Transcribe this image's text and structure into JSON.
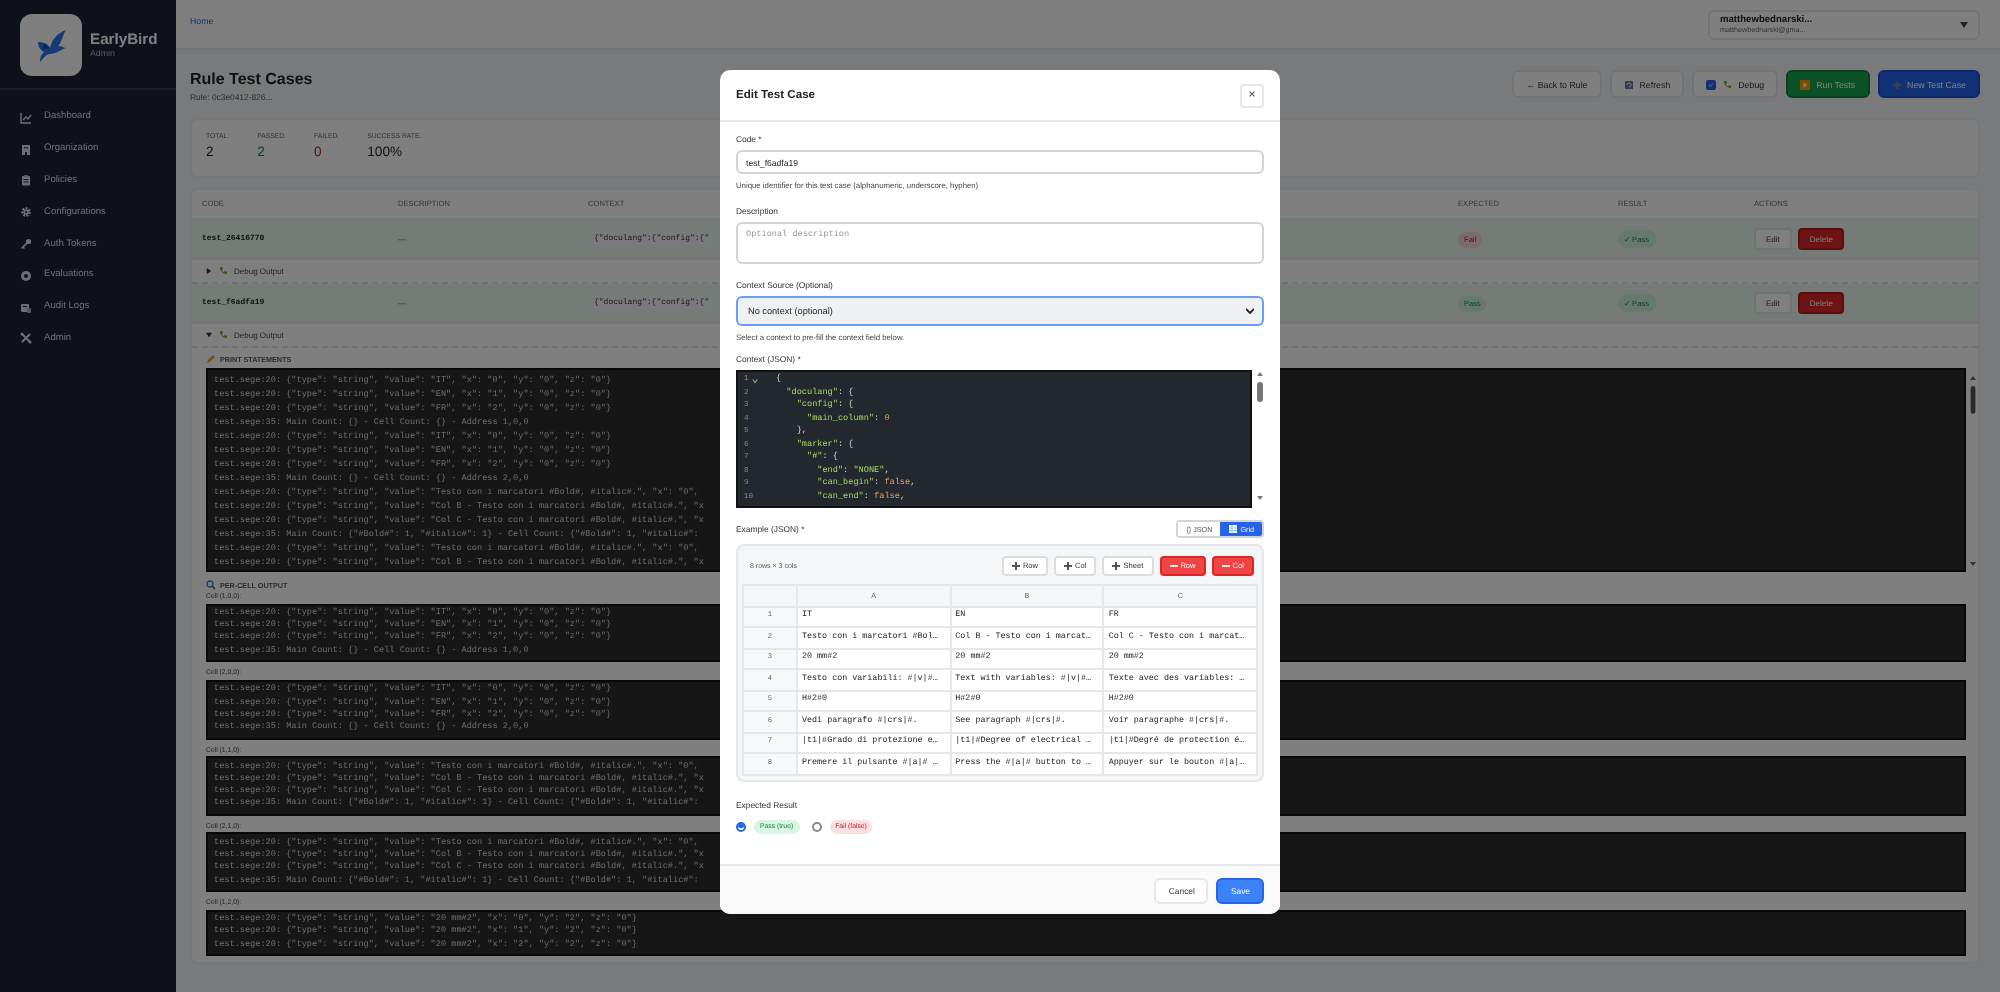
{
  "sidebar": {
    "brand": "EarlyBird",
    "role": "Admin",
    "items": [
      {
        "label": "Dashboard",
        "kind": "chart"
      },
      {
        "label": "Organization",
        "kind": "building"
      },
      {
        "label": "Policies",
        "kind": "clipboard"
      },
      {
        "label": "Configurations",
        "kind": "gear"
      },
      {
        "label": "Auth Tokens",
        "kind": "key"
      },
      {
        "label": "Evaluations",
        "kind": "target"
      },
      {
        "label": "Audit Logs",
        "kind": "scroll"
      },
      {
        "label": "Admin",
        "kind": "tools"
      }
    ]
  },
  "header": {
    "breadcrumb": "Home",
    "user_name": "matthewbednarski...",
    "user_email": "matthewbednarski@gma..."
  },
  "page": {
    "title": "Rule Test Cases",
    "subtitle": "Rule: 0c3e0412-826...",
    "actions": [
      {
        "label": "← Back to Rule",
        "kind": "plain"
      },
      {
        "label": "Refresh",
        "kind": "refresh"
      },
      {
        "label": "Debug",
        "kind": "toggle",
        "checked": true
      },
      {
        "label": "Run Tests",
        "kind": "run"
      },
      {
        "label": "New Test Case",
        "kind": "new"
      }
    ]
  },
  "stats": [
    {
      "label": "TOTAL:",
      "value": "2",
      "kind": "neutral"
    },
    {
      "label": "PASSED:",
      "value": "2",
      "kind": "pass"
    },
    {
      "label": "FAILED:",
      "value": "0",
      "kind": "fail"
    },
    {
      "label": "SUCCESS RATE:",
      "value": "100%",
      "kind": "neutral"
    }
  ],
  "table": {
    "columns": [
      "CODE",
      "DESCRIPTION",
      "CONTEXT",
      "EXPECTED",
      "RESULT",
      "ACTIONS"
    ],
    "rows": [
      {
        "code": "test_26416770",
        "description": "—",
        "context": "{\"doculang\":{\"config\":{\"",
        "expected": {
          "text": "Fail",
          "kind": "fail"
        },
        "result": {
          "text": "✓ Pass",
          "kind": "pass"
        },
        "actions": [
          "Edit",
          "Delete"
        ],
        "debug": {
          "label": "Debug Output",
          "expanded": false
        }
      },
      {
        "code": "test_f6adfa19",
        "description": "—",
        "context": "{\"doculang\":{\"config\":{\"",
        "expected": {
          "text": "Pass",
          "kind": "pass"
        },
        "result": {
          "text": "✓ Pass",
          "kind": "pass"
        },
        "actions": [
          "Edit",
          "Delete"
        ],
        "debug": {
          "label": "Debug Output",
          "expanded": true
        }
      }
    ]
  },
  "debug": {
    "print_title": "PRINT STATEMENTS",
    "print_lines": [
      "test.sege:20: {\"type\": \"string\", \"value\": \"IT\", \"x\": \"0\", \"y\": \"0\", \"z\": \"0\"}",
      "test.sege:20: {\"type\": \"string\", \"value\": \"EN\", \"x\": \"1\", \"y\": \"0\", \"z\": \"0\"}",
      "test.sege:20: {\"type\": \"string\", \"value\": \"FR\", \"x\": \"2\", \"y\": \"0\", \"z\": \"0\"}",
      "test.sege:35: Main Count: {} - Cell Count: {} - Address 1,0,0",
      "test.sege:20: {\"type\": \"string\", \"value\": \"IT\", \"x\": \"0\", \"y\": \"0\", \"z\": \"0\"}",
      "test.sege:20: {\"type\": \"string\", \"value\": \"EN\", \"x\": \"1\", \"y\": \"0\", \"z\": \"0\"}",
      "test.sege:20: {\"type\": \"string\", \"value\": \"FR\", \"x\": \"2\", \"y\": \"0\", \"z\": \"0\"}",
      "test.sege:35: Main Count: {} - Cell Count: {} - Address 2,0,0",
      "test.sege:20: {\"type\": \"string\", \"value\": \"Testo con i marcatori #Bold#, #italic#.\", \"x\": \"0\",",
      "test.sege:20: {\"type\": \"string\", \"value\": \"Col B - Testo con i marcatori #Bold#, #italic#.\", \"x",
      "test.sege:20: {\"type\": \"string\", \"value\": \"Col C - Testo con i marcatori #Bold#, #italic#.\", \"x",
      "test.sege:35: Main Count: {\"#Bold#\": 1, \"#italic#\": 1} - Cell Count: {\"#Bold#\": 1, \"#italic#\":",
      "test.sege:20: {\"type\": \"string\", \"value\": \"Testo con i marcatori #Bold#, #italic#.\", \"x\": \"0\",",
      "test.sege:20: {\"type\": \"string\", \"value\": \"Col B - Testo con i marcatori #Bold#, #italic#.\", \"x"
    ],
    "cell_title": "PER-CELL OUTPUT",
    "cells": [
      {
        "label": "Cell (1,0,0):",
        "lines": [
          "test.sege:20: {\"type\": \"string\", \"value\": \"IT\", \"x\": \"0\", \"y\": \"0\", \"z\": \"0\"}",
          "test.sege:20: {\"type\": \"string\", \"value\": \"EN\", \"x\": \"1\", \"y\": \"0\", \"z\": \"0\"}",
          "test.sege:20: {\"type\": \"string\", \"value\": \"FR\", \"x\": \"2\", \"y\": \"0\", \"z\": \"0\"}",
          "test.sege:35: Main Count: {} - Cell Count: {} - Address 1,0,0"
        ]
      },
      {
        "label": "Cell (2,0,0):",
        "lines": [
          "test.sege:20: {\"type\": \"string\", \"value\": \"IT\", \"x\": \"0\", \"y\": \"0\", \"z\": \"0\"}",
          "test.sege:20: {\"type\": \"string\", \"value\": \"EN\", \"x\": \"1\", \"y\": \"0\", \"z\": \"0\"}",
          "test.sege:20: {\"type\": \"string\", \"value\": \"FR\", \"x\": \"2\", \"y\": \"0\", \"z\": \"0\"}",
          "test.sege:35: Main Count: {} - Cell Count: {} - Address 2,0,0"
        ]
      },
      {
        "label": "Cell (1,1,0):",
        "lines": [
          "test.sege:20: {\"type\": \"string\", \"value\": \"Testo con i marcatori #Bold#, #italic#.\", \"x\": \"0\",",
          "test.sege:20: {\"type\": \"string\", \"value\": \"Col B - Testo con i marcatori #Bold#, #italic#.\", \"x",
          "test.sege:20: {\"type\": \"string\", \"value\": \"Col C - Testo con i marcatori #Bold#, #italic#.\", \"x",
          "test.sege:35: Main Count: {\"#Bold#\": 1, \"#italic#\": 1} - Cell Count: {\"#Bold#\": 1, \"#italic#\":"
        ]
      },
      {
        "label": "Cell (2,1,0):",
        "lines": [
          "test.sege:20: {\"type\": \"string\", \"value\": \"Testo con i marcatori #Bold#, #italic#.\", \"x\": \"0\",",
          "test.sege:20: {\"type\": \"string\", \"value\": \"Col B - Testo con i marcatori #Bold#, #italic#.\", \"x",
          "test.sege:20: {\"type\": \"string\", \"value\": \"Col C - Testo con i marcatori #Bold#, #italic#.\", \"x",
          "test.sege:35: Main Count: {\"#Bold#\": 1, \"#italic#\": 1} - Cell Count: {\"#Bold#\": 1, \"#italic#\":"
        ]
      },
      {
        "label": "Cell (1,2,0):",
        "lines": [
          "test.sege:20: {\"type\": \"string\", \"value\": \"20 mm#2\", \"x\": \"0\", \"y\": \"2\", \"z\": \"0\"}",
          "test.sege:20: {\"type\": \"string\", \"value\": \"20 mm#2\", \"x\": \"1\", \"y\": \"2\", \"z\": \"0\"}",
          "test.sege:20: {\"type\": \"string\", \"value\": \"20 mm#2\", \"x\": \"2\", \"y\": \"2\", \"z\": \"0\"}"
        ]
      }
    ]
  },
  "modal": {
    "title": "Edit Test Case",
    "close": "×",
    "code": {
      "label": "Code *",
      "value": "test_f6adfa19",
      "hint": "Unique identifier for this test case (alphanumeric, underscore, hyphen)"
    },
    "description": {
      "label": "Description",
      "placeholder": "Optional description"
    },
    "context_source": {
      "label": "Context Source (Optional)",
      "value": "No context (optional)",
      "hint": "Select a context to pre-fill the context field below."
    },
    "context": {
      "label": "Context (JSON) *",
      "lines": [
        {
          "number": "1",
          "text": "{"
        },
        {
          "number": "2",
          "text": "  \"doculang\": {"
        },
        {
          "number": "3",
          "text": "    \"config\": {"
        },
        {
          "number": "4",
          "text": "      \"main_column\": 0"
        },
        {
          "number": "5",
          "text": "    },"
        },
        {
          "number": "6",
          "text": "    \"marker\": {"
        },
        {
          "number": "7",
          "text": "      \"#\": {"
        },
        {
          "number": "8",
          "text": "        \"end\": \"NONE\","
        },
        {
          "number": "9",
          "text": "        \"can_begin\": false,"
        },
        {
          "number": "10",
          "text": "        \"can_end\": false,"
        }
      ]
    },
    "example": {
      "label": "Example (JSON) *",
      "views": [
        {
          "label": "{} JSON",
          "kind": "json",
          "selected": false
        },
        {
          "label": "Grid",
          "kind": "grid",
          "selected": true
        }
      ],
      "size": "8 rows × 3 cols",
      "buttons": [
        {
          "label": "Row",
          "kind": "add"
        },
        {
          "label": "Col",
          "kind": "add"
        },
        {
          "label": "Sheet",
          "kind": "add"
        },
        {
          "label": "Row",
          "kind": "remove"
        },
        {
          "label": "Col",
          "kind": "remove"
        }
      ],
      "columns": [
        "A",
        "B",
        "C"
      ],
      "rows": [
        {
          "number": "1",
          "cells": [
            "IT",
            "EN",
            "FR"
          ]
        },
        {
          "number": "2",
          "cells": [
            "Testo con i marcatori #Bol…",
            "Col B - Testo con i marcat…",
            "Col C - Testo con i marcat…"
          ]
        },
        {
          "number": "3",
          "cells": [
            "20 mm#2",
            "20 mm#2",
            "20 mm#2"
          ]
        },
        {
          "number": "4",
          "cells": [
            "Testo con variabili: #|v|#…",
            "Text with variables: #|v|#…",
            "Texte avec des variables: …"
          ]
        },
        {
          "number": "5",
          "cells": [
            "H#2#0",
            "H#2#0",
            "H#2#0"
          ]
        },
        {
          "number": "6",
          "cells": [
            "Vedi paragrafo #|crs|#.",
            "See paragraph #|crs|#.",
            "Voir paragraphe #|crs|#."
          ]
        },
        {
          "number": "7",
          "cells": [
            "|t1|#Grado di protezione e…",
            "|t1|#Degree of electrical …",
            "|t1|#Degré de protection é…"
          ]
        },
        {
          "number": "8",
          "cells": [
            "Premere il pulsante #|a|# …",
            "Press the #|a|# button to …",
            "Appuyer sur le bouton #|a|…"
          ]
        }
      ]
    },
    "expected": {
      "label": "Expected Result",
      "options": [
        {
          "label": "Pass (true)",
          "kind": "pass",
          "selected": true
        },
        {
          "label": "Fail (false)",
          "kind": "fail",
          "selected": false
        }
      ]
    },
    "buttons": [
      {
        "label": "Cancel",
        "kind": "secondary"
      },
      {
        "label": "Save",
        "kind": "primary"
      }
    ]
  }
}
